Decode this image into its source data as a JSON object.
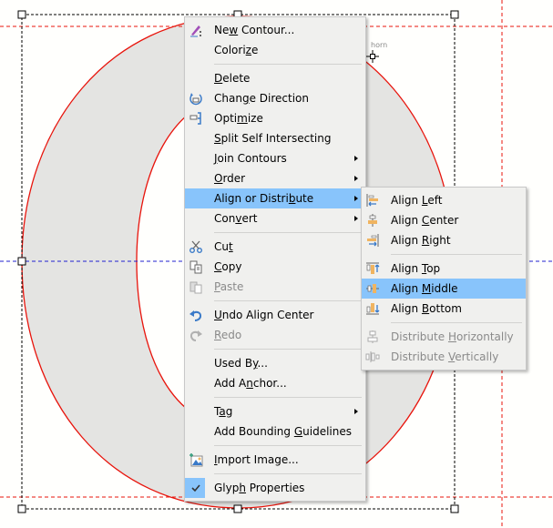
{
  "canvas": {
    "glyph_fill": "#e4e4e2",
    "contour_color": "#e8140c",
    "guideline_color": "#e8140c",
    "baseline_color": "#2020d0",
    "anchor_label": "horn"
  },
  "context_menu": {
    "items": [
      {
        "id": "new-contour",
        "pre": "Ne",
        "u": "w",
        "post": " Contour...",
        "icon": "pencil-icon",
        "disabled": false,
        "submenu": false
      },
      {
        "id": "colorize",
        "pre": "Colori",
        "u": "z",
        "post": "e",
        "icon": null,
        "disabled": false,
        "submenu": false
      },
      {
        "sep": true
      },
      {
        "id": "delete",
        "pre": "",
        "u": "D",
        "post": "elete",
        "icon": null,
        "disabled": false,
        "submenu": false
      },
      {
        "id": "change-direction",
        "pre": "Chan",
        "u": "g",
        "post": "e Direction",
        "icon": "change-direction-icon",
        "disabled": false,
        "submenu": false
      },
      {
        "id": "optimize",
        "pre": "Opti",
        "u": "m",
        "post": "ize",
        "icon": "optimize-icon",
        "disabled": false,
        "submenu": false
      },
      {
        "id": "split-self-intersecting",
        "pre": "",
        "u": "S",
        "post": "plit Self Intersecting",
        "icon": null,
        "disabled": false,
        "submenu": false
      },
      {
        "id": "join-contours",
        "pre": "",
        "u": "J",
        "post": "oin Contours",
        "icon": null,
        "disabled": false,
        "submenu": true
      },
      {
        "id": "order",
        "pre": "",
        "u": "O",
        "post": "rder",
        "icon": null,
        "disabled": false,
        "submenu": true
      },
      {
        "id": "align-or-distribute",
        "pre": "Align or Distri",
        "u": "b",
        "post": "ute",
        "icon": null,
        "disabled": false,
        "submenu": true,
        "highlighted": true
      },
      {
        "id": "convert",
        "pre": "Con",
        "u": "v",
        "post": "ert",
        "icon": null,
        "disabled": false,
        "submenu": true
      },
      {
        "sep": true
      },
      {
        "id": "cut",
        "pre": "Cu",
        "u": "t",
        "post": "",
        "icon": "scissors-icon",
        "disabled": false,
        "submenu": false
      },
      {
        "id": "copy",
        "pre": "",
        "u": "C",
        "post": "opy",
        "icon": "copy-icon",
        "disabled": false,
        "submenu": false
      },
      {
        "id": "paste",
        "pre": "",
        "u": "P",
        "post": "aste",
        "icon": "paste-icon",
        "disabled": true,
        "submenu": false
      },
      {
        "sep": true
      },
      {
        "id": "undo",
        "pre": "",
        "u": "U",
        "post": "ndo Align Center",
        "icon": "undo-icon",
        "disabled": false,
        "submenu": false
      },
      {
        "id": "redo",
        "pre": "",
        "u": "R",
        "post": "edo",
        "icon": "redo-icon",
        "disabled": true,
        "submenu": false
      },
      {
        "sep": true
      },
      {
        "id": "used-by",
        "pre": "Used B",
        "u": "y",
        "post": "...",
        "icon": null,
        "disabled": false,
        "submenu": false
      },
      {
        "id": "add-anchor",
        "pre": "Add A",
        "u": "n",
        "post": "chor...",
        "icon": null,
        "disabled": false,
        "submenu": false
      },
      {
        "sep": true
      },
      {
        "id": "tag",
        "pre": "T",
        "u": "a",
        "post": "g",
        "icon": null,
        "disabled": false,
        "submenu": true
      },
      {
        "id": "add-bounding-guidelines",
        "pre": "Add Bounding ",
        "u": "G",
        "post": "uidelines",
        "icon": null,
        "disabled": false,
        "submenu": false
      },
      {
        "sep": true
      },
      {
        "id": "import-image",
        "pre": "",
        "u": "I",
        "post": "mport Image...",
        "icon": "import-image-icon",
        "disabled": false,
        "submenu": false
      },
      {
        "sep": true
      },
      {
        "id": "glyph-properties",
        "pre": "Glyp",
        "u": "h",
        "post": " Properties",
        "icon": "checkmark-icon",
        "disabled": false,
        "submenu": false,
        "checked": true
      }
    ]
  },
  "submenu": {
    "items": [
      {
        "id": "align-left",
        "pre": "Align ",
        "u": "L",
        "post": "eft",
        "icon": "align-left-icon",
        "disabled": false
      },
      {
        "id": "align-center",
        "pre": "Align ",
        "u": "C",
        "post": "enter",
        "icon": "align-center-icon",
        "disabled": false
      },
      {
        "id": "align-right",
        "pre": "Align ",
        "u": "R",
        "post": "ight",
        "icon": "align-right-icon",
        "disabled": false
      },
      {
        "sep": true
      },
      {
        "id": "align-top",
        "pre": "Align ",
        "u": "T",
        "post": "op",
        "icon": "align-top-icon",
        "disabled": false
      },
      {
        "id": "align-middle",
        "pre": "Align ",
        "u": "M",
        "post": "iddle",
        "icon": "align-middle-icon",
        "disabled": false,
        "highlighted": true
      },
      {
        "id": "align-bottom",
        "pre": "Align ",
        "u": "B",
        "post": "ottom",
        "icon": "align-bottom-icon",
        "disabled": false
      },
      {
        "sep": true
      },
      {
        "id": "distribute-horizontally",
        "pre": "Distribute ",
        "u": "H",
        "post": "orizontally",
        "icon": "distribute-horizontally-icon",
        "disabled": true
      },
      {
        "id": "distribute-vertically",
        "pre": "Distribute ",
        "u": "V",
        "post": "ertically",
        "icon": "distribute-vertically-icon",
        "disabled": true
      }
    ]
  }
}
